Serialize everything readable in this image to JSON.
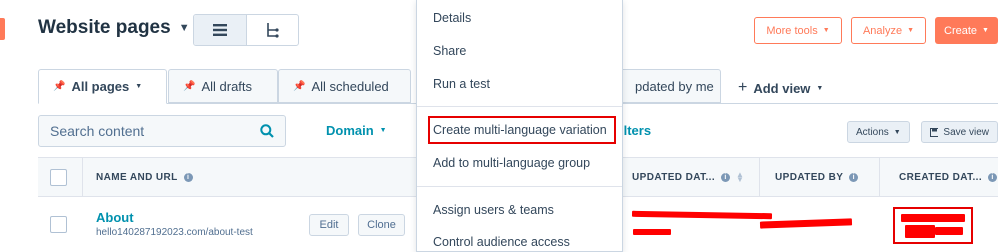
{
  "header": {
    "title": "Website pages",
    "more_tools": "More tools",
    "analyze": "Analyze",
    "create": "Create"
  },
  "tabs": [
    {
      "label": "All pages"
    },
    {
      "label": "All drafts"
    },
    {
      "label": "All scheduled"
    },
    {
      "label": "pdated by me"
    }
  ],
  "add_view_label": "Add view",
  "search": {
    "placeholder": "Search content"
  },
  "filters": {
    "domain_label": "Domain",
    "advanced_filters_label": "ilters",
    "actions_label": "Actions",
    "save_view_label": "Save view"
  },
  "table": {
    "columns": {
      "name": "NAME AND URL",
      "updated_date": "UPDATED DAT...",
      "updated_by": "UPDATED BY",
      "created_date": "CREATED DAT..."
    },
    "rows": [
      {
        "name": "About",
        "url": "hello140287192023.com/about-test",
        "edit": "Edit",
        "clone": "Clone"
      }
    ]
  },
  "context_menu": {
    "items": [
      "Details",
      "Share",
      "Run a test",
      "Create multi-language variation",
      "Add to multi-language group",
      "Assign users & teams",
      "Control audience access"
    ],
    "highlighted_index": 3
  },
  "colors": {
    "accent": "#ff7a59",
    "link": "#0091ae",
    "text": "#33475b",
    "annotation_red": "#e60000"
  },
  "icons": [
    "list-view-icon",
    "tree-view-icon",
    "pin-icon",
    "search-icon",
    "plus-icon",
    "save-icon",
    "info-icon",
    "sort-icon"
  ]
}
